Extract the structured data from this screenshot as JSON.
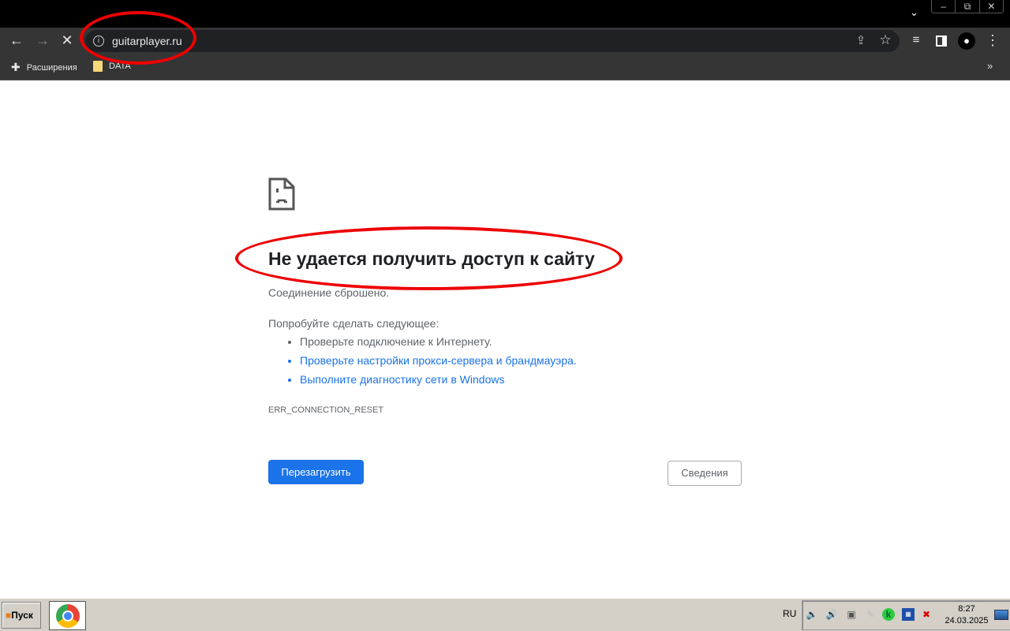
{
  "browser": {
    "url": "guitarplayer.ru",
    "bookmarks": [
      {
        "label": "Расширения"
      },
      {
        "label": "DATA"
      }
    ]
  },
  "error": {
    "title": "Не удается получить доступ к сайту",
    "subtitle": "Соединение сброшено.",
    "try_label": "Попробуйте сделать следующее:",
    "suggestions": [
      "Проверьте подключение к Интернету.",
      "Проверьте настройки прокси-сервера и брандмауэра.",
      "Выполните диагностику сети в Windows"
    ],
    "code": "ERR_CONNECTION_RESET",
    "reload_label": "Перезагрузить",
    "details_label": "Сведения"
  },
  "taskbar": {
    "start_label": "Пуск",
    "language": "RU",
    "time": "8:27",
    "date": "24.03.2025"
  },
  "colors": {
    "accent": "#1a73e8",
    "annotation": "#e00000"
  }
}
